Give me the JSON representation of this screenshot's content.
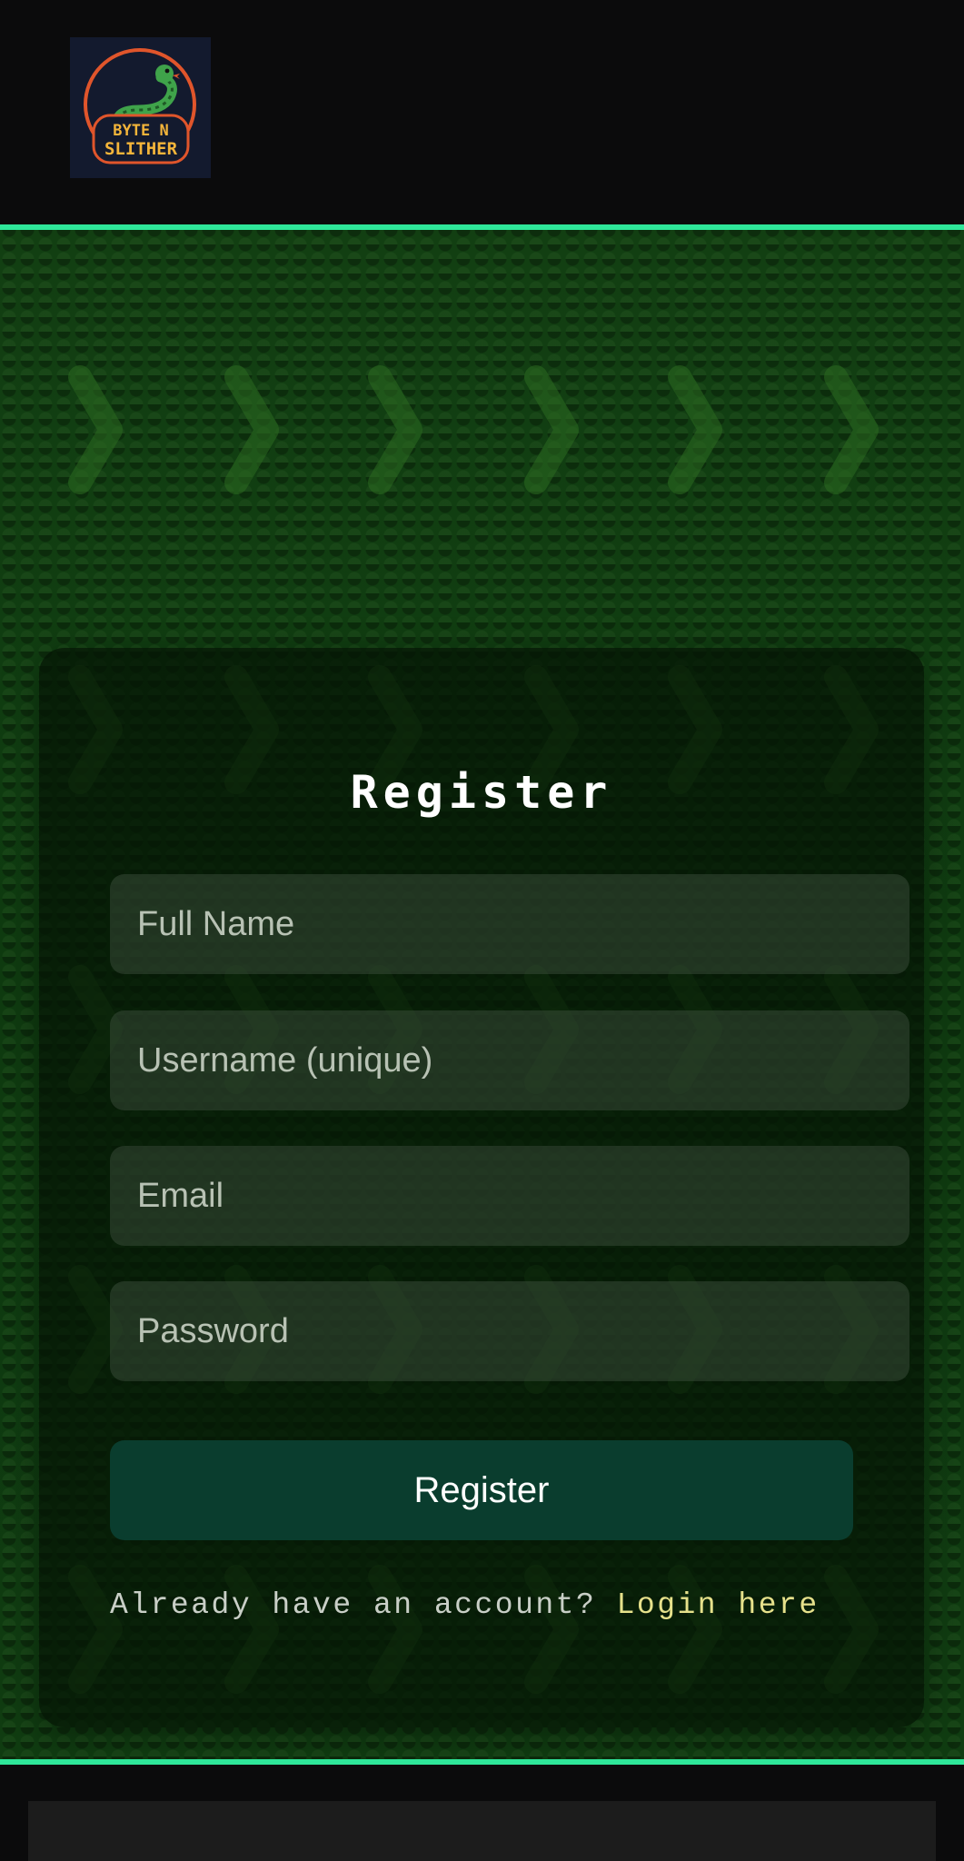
{
  "header": {
    "logo": {
      "icon": "snake-icon",
      "line1": "BYTE N",
      "line2": "SLITHER"
    }
  },
  "form": {
    "title": "Register",
    "fields": {
      "full_name_placeholder": "Full Name",
      "username_placeholder": "Username (unique)",
      "email_placeholder": "Email",
      "password_placeholder": "Password"
    },
    "submit_label": "Register",
    "login_prompt": "Already have an account? ",
    "login_link": "Login here"
  },
  "colors": {
    "accent_line": "#2fe79a",
    "background_green": "#0f3a10",
    "button": "#0a3d2e",
    "link": "#e6e18b"
  }
}
